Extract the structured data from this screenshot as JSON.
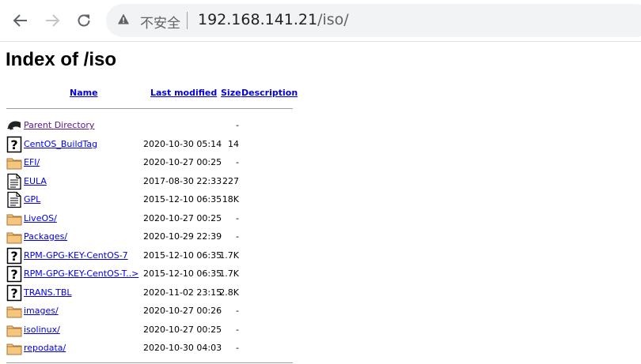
{
  "browser": {
    "insecure_label": "不安全",
    "url_host": "192.168.141.21",
    "url_path": "/iso/"
  },
  "page": {
    "title": "Index of /iso",
    "columns": {
      "name": "Name",
      "last_modified": "Last modified",
      "size": "Size",
      "description": "Description"
    }
  },
  "entries": [
    {
      "icon": "back-icon",
      "name": "Parent Directory",
      "date": "",
      "size": "-"
    },
    {
      "icon": "unknown-file-icon",
      "name": "CentOS_BuildTag",
      "date": "2020-10-30 05:14",
      "size": "14"
    },
    {
      "icon": "folder-icon",
      "name": "EFI/",
      "date": "2020-10-27 00:25",
      "size": "-"
    },
    {
      "icon": "text-file-icon",
      "name": "EULA",
      "date": "2017-08-30 22:33",
      "size": "227"
    },
    {
      "icon": "text-file-icon",
      "name": "GPL",
      "date": "2015-12-10 06:35",
      "size": "18K"
    },
    {
      "icon": "folder-icon",
      "name": "LiveOS/",
      "date": "2020-10-27 00:25",
      "size": "-"
    },
    {
      "icon": "folder-icon",
      "name": "Packages/",
      "date": "2020-10-29 22:39",
      "size": "-"
    },
    {
      "icon": "unknown-file-icon",
      "name": "RPM-GPG-KEY-CentOS-7",
      "date": "2015-12-10 06:35",
      "size": "1.7K"
    },
    {
      "icon": "unknown-file-icon",
      "name": "RPM-GPG-KEY-CentOS-T..>",
      "date": "2015-12-10 06:35",
      "size": "1.7K"
    },
    {
      "icon": "unknown-file-icon",
      "name": "TRANS.TBL",
      "date": "2020-11-02 23:15",
      "size": "2.8K"
    },
    {
      "icon": "folder-icon",
      "name": "images/",
      "date": "2020-10-27 00:26",
      "size": "-"
    },
    {
      "icon": "folder-icon",
      "name": "isolinux/",
      "date": "2020-10-27 00:25",
      "size": "-"
    },
    {
      "icon": "folder-icon",
      "name": "repodata/",
      "date": "2020-10-30 04:03",
      "size": "-"
    }
  ]
}
